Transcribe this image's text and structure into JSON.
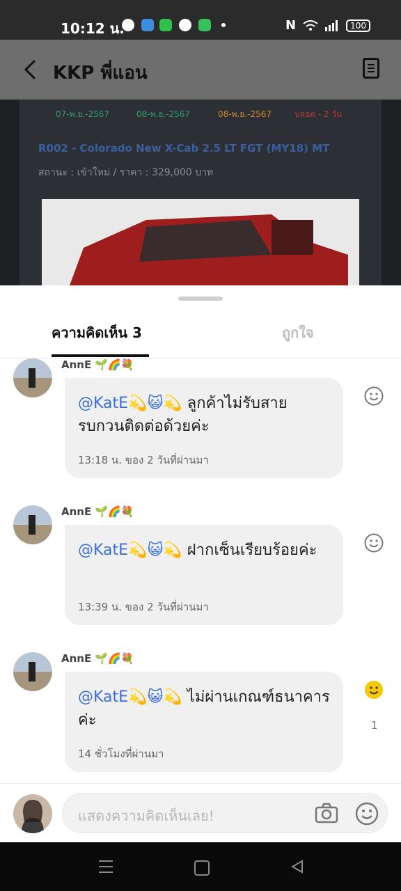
{
  "status_bar": {
    "time": "10:12 น.",
    "battery": "100",
    "app_icons": [
      "messenger-icon",
      "app-icon",
      "shop-icon",
      "line-icon",
      "messages-icon"
    ],
    "system_icons": [
      "nfc-icon",
      "wifi-icon",
      "signal-icon"
    ]
  },
  "app_bar": {
    "title": "KKP พี่แอน",
    "back_icon": "back-arrow-icon",
    "menu_icon": "document-icon"
  },
  "background_post": {
    "dates": [
      "07-พ.ย.-2567",
      "08-พ.ย.-2567",
      "08-พ.ย.-2567",
      "ปลอด - 2 วัน"
    ],
    "date_colors": [
      "#2e9e6d",
      "#2e9e6d",
      "#d3892c",
      "#b03a3a"
    ],
    "car_title": "R002 - Colorado New X-Cab 2.5 LT FGT (MY18) MT",
    "car_status": "สถานะ : เข้าใหม่ / ราคา : 329,000 บาท"
  },
  "sheet": {
    "tabs": [
      {
        "label": "ความคิดเห็น 3",
        "active": true
      },
      {
        "label": "ถูกใจ",
        "active": false
      }
    ]
  },
  "comments": [
    {
      "author": "AnnE 🌱🌈💐",
      "mention": "@KatE💫😺💫",
      "text": " ลูกค้าไม่รับสาย รบกวนติดต่อด้วยค่ะ",
      "time": "13:18 น. ของ 2 วันที่ผ่านมา",
      "reaction_count": ""
    },
    {
      "author": "AnnE 🌱🌈💐",
      "mention": "@KatE💫😺💫",
      "text": " ฝากเซ็นเรียบร้อยค่ะ",
      "time": "13:39 น. ของ 2 วันที่ผ่านมา",
      "reaction_count": ""
    },
    {
      "author": "AnnE 🌱🌈💐",
      "mention": "@KatE💫😺💫",
      "text": " ไม่ผ่านเกณฑ์ธนาคารค่ะ",
      "time": "14 ชั่วโมงที่ผ่านมา",
      "reaction_count": "1"
    }
  ],
  "input": {
    "placeholder": "แสดงความคิดเห็นเลย!"
  },
  "colors": {
    "mention": "#3b6fd6",
    "reaction_active": "#f5c800",
    "tab_active": "#111111",
    "tab_inactive": "#bdbdbd"
  }
}
